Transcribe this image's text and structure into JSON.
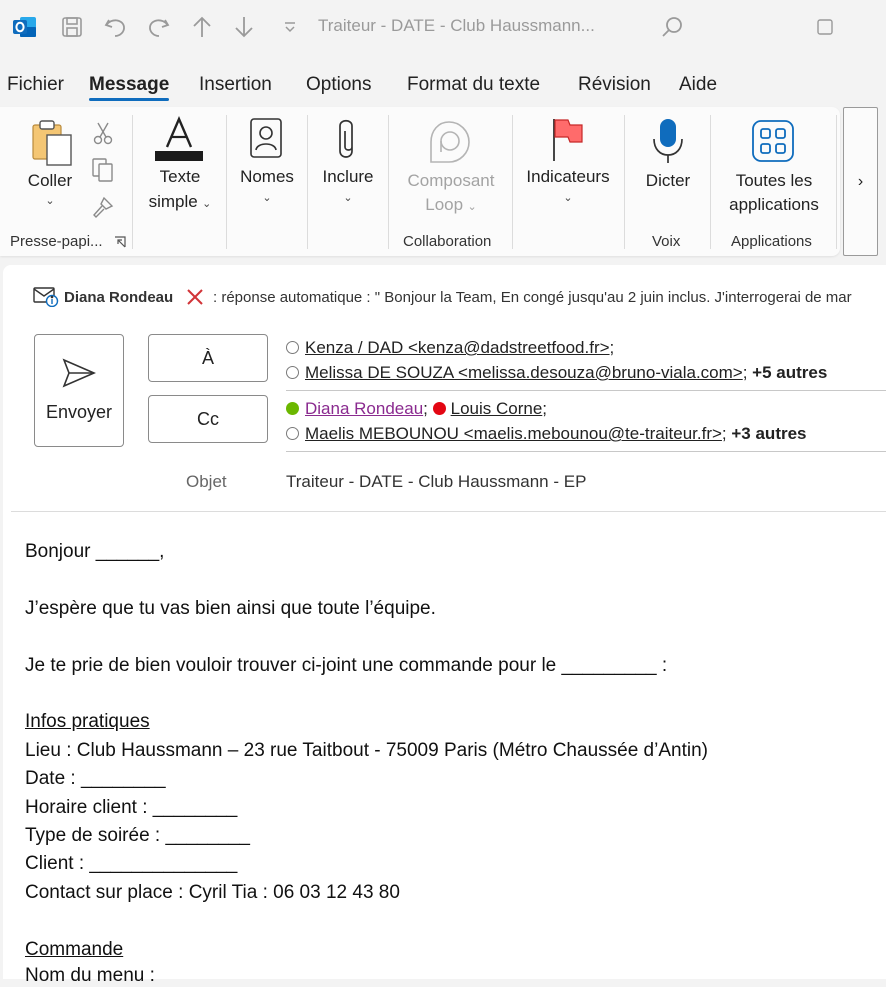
{
  "window": {
    "title": "Traiteur - DATE - Club Haussmann..."
  },
  "titlebar_icons": [
    "outlook-icon",
    "save-icon",
    "undo-icon",
    "redo-icon",
    "up-arrow-icon",
    "down-arrow-icon",
    "customize-icon",
    "search-icon",
    "maximize-icon"
  ],
  "menu": {
    "tabs": [
      "Fichier",
      "Message",
      "Insertion",
      "Options",
      "Format du texte",
      "Révision",
      "Aide"
    ],
    "active": "Message"
  },
  "ribbon": {
    "paste": "Coller",
    "clipboard_group": "Presse-papi...",
    "text_line1": "Texte",
    "text_line2": "simple",
    "names": "Nomes",
    "include": "Inclure",
    "loop_line1": "Composant",
    "loop_line2": "Loop",
    "collab_group": "Collaboration",
    "flags": "Indicateurs",
    "dictate": "Dicter",
    "voice_group": "Voix",
    "apps_line1": "Toutes les",
    "apps_line2": "applications",
    "apps_group": "Applications",
    "more": "›"
  },
  "compose": {
    "info": {
      "sender": "Diana Rondeau",
      "message": ": réponse automatique : \"   Bonjour la Team,   En congé jusqu'au 2 juin inclus. J'interrogerai de mar"
    },
    "send_label": "Envoyer",
    "to_label": "À",
    "cc_label": "Cc",
    "subject_label": "Objet",
    "subject_value": "Traiteur - DATE - Club Haussmann - EP",
    "to": {
      "r1": "Kenza / DAD <kenza@dadstreetfood.fr>",
      "r2": "Melissa DE SOUZA <melissa.desouza@bruno-viala.com>",
      "more": "+5 autres"
    },
    "cc": {
      "r1": "Diana Rondeau",
      "r2": "Louis Corne",
      "r3": "Maelis MEBOUNOU <maelis.mebounou@te-traiteur.fr>",
      "more": "+3 autres"
    }
  },
  "body": {
    "greeting": "Bonjour ______,",
    "line1": "J’espère que tu vas bien ainsi que toute l’équipe.",
    "line2": "Je te prie de bien vouloir trouver ci-joint une commande pour le _________ :",
    "section1": "Infos pratiques",
    "lieu": "Lieu : Club Haussmann – 23 rue Taitbout - 75009 Paris (Métro Chaussée d’Antin)",
    "date": "Date : ________",
    "horaire": "Horaire client :  ________",
    "type": "Type de soirée : ________",
    "client": "Client : ______________",
    "contact": "Contact sur place : Cyril Tia : 06 03 12 43 80",
    "section2": "Commande",
    "menu": "Nom du menu :"
  }
}
